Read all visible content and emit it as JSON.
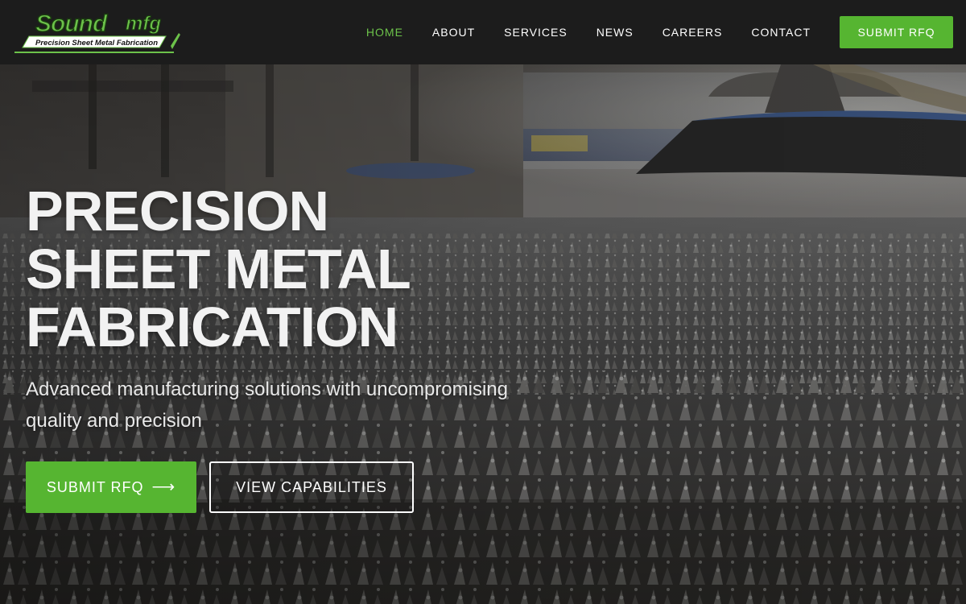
{
  "brand": {
    "logo_word": "Soundmfg",
    "logo_word_main": "Sound",
    "logo_word_suffix": "mfg",
    "logo_tagline": "Precision Sheet Metal Fabrication",
    "accent_color": "#56b531",
    "accent_active_color": "#6cc24a"
  },
  "nav": {
    "items": [
      {
        "label": "HOME",
        "active": true
      },
      {
        "label": "ABOUT",
        "active": false
      },
      {
        "label": "SERVICES",
        "active": false
      },
      {
        "label": "NEWS",
        "active": false
      },
      {
        "label": "CAREERS",
        "active": false
      },
      {
        "label": "CONTACT",
        "active": false
      }
    ],
    "cta_label": "SUBMIT RFQ"
  },
  "hero": {
    "title_lines": [
      "PRECISION",
      "SHEET METAL",
      "FABRICATION"
    ],
    "subtitle": "Advanced manufacturing solutions with uncompromising quality and precision",
    "primary_button": {
      "label": "SUBMIT RFQ",
      "icon": "arrow-right-icon",
      "glyph": "⟶"
    },
    "secondary_button": {
      "label": "VIEW CAPABILITIES"
    },
    "background_image": "factory floor with metal parts and cutting machinery"
  }
}
